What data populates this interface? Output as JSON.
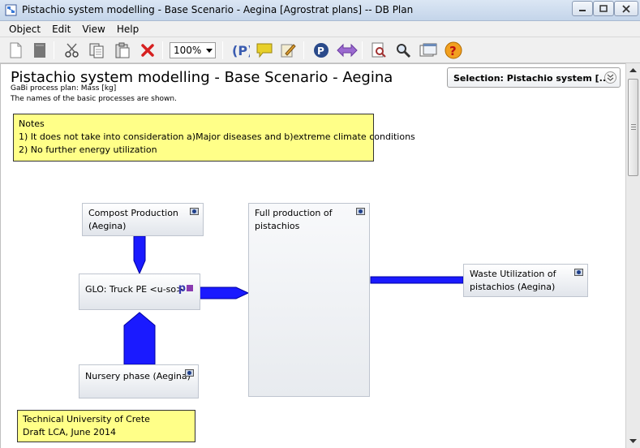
{
  "window": {
    "title": "Pistachio system modelling - Base Scenario - Aegina [Agrostrat plans] -- DB Plan"
  },
  "menu": [
    "Object",
    "Edit",
    "View",
    "Help"
  ],
  "toolbar": {
    "zoom_value": "100%",
    "icons": [
      "new-document-icon",
      "new-plan-icon",
      "cut-icon",
      "copy-icon",
      "paste-icon",
      "delete-icon",
      "process-p-icon",
      "comment-icon",
      "edit-icon",
      "parameter-icon",
      "flow-arrow-icon",
      "preview-icon",
      "search-icon",
      "window-icon",
      "help-icon"
    ]
  },
  "plan": {
    "title": "Pistachio system modelling - Base Scenario - Aegina",
    "subtitle1": "GaBi process plan: Mass [kg]",
    "subtitle2": "The names of the basic processes are shown.",
    "selection_label": "Selection: Pistachio system  [...]"
  },
  "notes": {
    "top": [
      "Notes",
      "1) It does not take into consideration a)Major diseases and b)extreme climate conditions",
      "2) No further energy utilization"
    ],
    "bottom": [
      "Technical University of Crete",
      "Draft LCA, June 2014"
    ]
  },
  "processes": {
    "compost": [
      "Compost Production",
      "(Aegina)"
    ],
    "truck": "GLO: Truck PE <u-so>",
    "truck_badge": "p",
    "nursery": "Nursery phase (Aegina)",
    "full": [
      "Full production of",
      "pistachios"
    ],
    "waste": [
      "Waste Utilization of",
      "pistachios (Aegina)"
    ]
  },
  "colors": {
    "flow": "#1a1aff",
    "note_bg": "#ffff88",
    "titlebar": "#c4d5ea"
  }
}
